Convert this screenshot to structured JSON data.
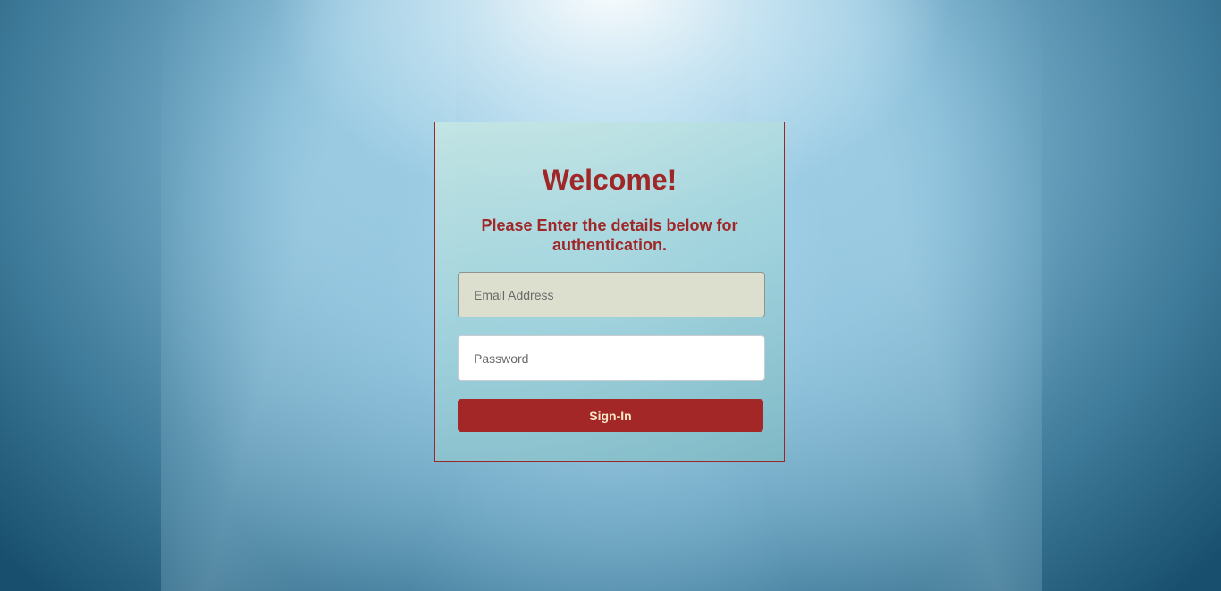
{
  "login": {
    "title": "Welcome!",
    "subtitle": "Please Enter the details below for authentication.",
    "email": {
      "placeholder": "Email Address",
      "value": ""
    },
    "password": {
      "placeholder": "Password",
      "value": ""
    },
    "signin_label": "Sign-In"
  },
  "colors": {
    "accent": "#a32727",
    "button_text": "#fbe7c8",
    "card_border": "#9a2626"
  }
}
